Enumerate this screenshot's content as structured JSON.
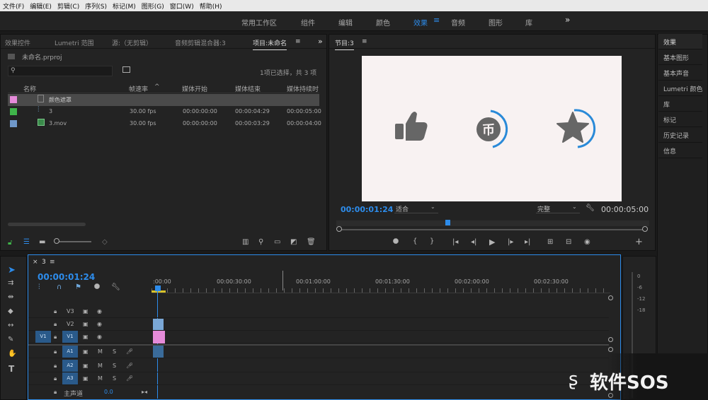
{
  "menubar": {
    "items": [
      "文件(F)",
      "编辑(E)",
      "剪辑(C)",
      "序列(S)",
      "标记(M)",
      "图形(G)",
      "窗口(W)",
      "帮助(H)"
    ]
  },
  "workspaces": {
    "items": [
      "常用工作区",
      "组件",
      "编辑",
      "颜色",
      "效果",
      "音频",
      "图形",
      "库"
    ],
    "active": "效果",
    "overflow": "»"
  },
  "source_panel": {
    "tabs": [
      "效果控件",
      "Lumetri 范围",
      "源:（无剪辑）",
      "音频剪辑混合器:3",
      "项目:未命名"
    ],
    "active_tab": "项目:未命名",
    "overflow": "»"
  },
  "project": {
    "file_name": "未命名.prproj",
    "search_placeholder": "",
    "selection_info": "1项已选择，共 3 项",
    "columns": [
      "名称",
      "帧速率",
      "媒体开始",
      "媒体结束",
      "媒体持续时"
    ],
    "rows": [
      {
        "name": "颜色遮罩",
        "fps": "",
        "start": "",
        "end": "",
        "duration": "",
        "color": "#e58bd9",
        "selected": true
      },
      {
        "name": "3",
        "fps": "30.00 fps",
        "start": "00:00:00:00",
        "end": "00:00:04:29",
        "duration": "00:00:05:00",
        "color": "#3fb54a",
        "selected": false
      },
      {
        "name": "3.mov",
        "fps": "30.00 fps",
        "start": "00:00:00:00",
        "end": "00:00:03:29",
        "duration": "00:00:04:00",
        "color": "#6f98c9",
        "selected": false
      }
    ]
  },
  "program": {
    "title": "节目:3",
    "timecode": "00:00:01:24",
    "fit": "适合",
    "quality": "完整",
    "duration": "00:00:05:00",
    "playhead_fraction": 0.35
  },
  "right_panel": {
    "items": [
      "效果",
      "基本图形",
      "基本声音",
      "Lumetri 颜色",
      "库",
      "标记",
      "历史记录",
      "信息"
    ]
  },
  "timeline": {
    "sequence": "3",
    "timecode": "00:00:01:24",
    "ruler": [
      ":00:00",
      "00:00:30:00",
      "00:01:00:00",
      "00:01:30:00",
      "00:02:00:00",
      "00:02:30:00"
    ],
    "video_tracks": [
      "V3",
      "V2",
      "V1"
    ],
    "audio_tracks": [
      "A1",
      "A2",
      "A3"
    ],
    "source_patch_video": "V1",
    "master_label": "主声道",
    "master_value": "0.0",
    "m_label": "M",
    "s_label": "S"
  },
  "meters": {
    "labels": [
      "0",
      "-6",
      "-12",
      "-18"
    ]
  },
  "watermark": {
    "text": "软件SOS"
  },
  "colors": {
    "accent": "#2d8ceb",
    "selected_row": "#4a4a4a",
    "clip_v2": "#7aa7d6",
    "clip_v1": "#e58bd9",
    "clip_a1": "#3a6b9a",
    "monitor_bg": "#f8f2f2",
    "icon_gray": "#666666",
    "ring_blue": "#2a8ad8"
  }
}
